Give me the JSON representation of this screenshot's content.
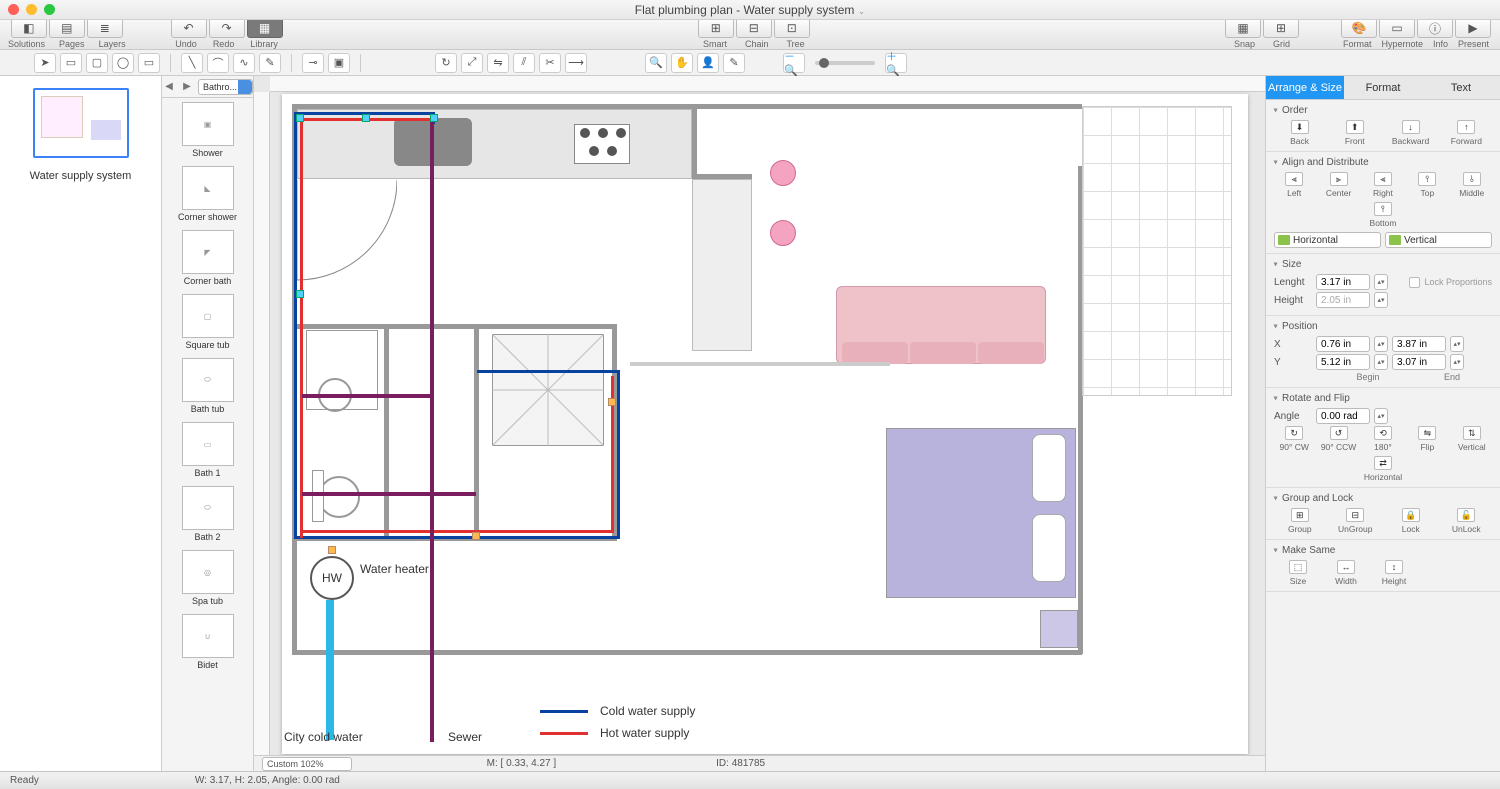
{
  "window": {
    "title": "Flat plumbing plan - Water supply system"
  },
  "toolbar": {
    "solutions": "Solutions",
    "pages": "Pages",
    "layers": "Layers",
    "undo": "Undo",
    "redo": "Redo",
    "library": "Library",
    "smart": "Smart",
    "chain": "Chain",
    "tree": "Tree",
    "snap": "Snap",
    "grid": "Grid",
    "format": "Format",
    "hypernote": "Hypernote",
    "info": "Info",
    "present": "Present"
  },
  "pages_panel": {
    "page1_name": "Water supply system"
  },
  "library": {
    "selector": "Bathro...",
    "items": [
      "Shower",
      "Corner shower",
      "Corner bath",
      "Square tub",
      "Bath tub",
      "Bath 1",
      "Bath 2",
      "Spa tub",
      "Bidet"
    ]
  },
  "canvas_labels": {
    "water_heater": "Water heater",
    "hw": "HW",
    "city_cold": "City cold water",
    "sewer": "Sewer",
    "cold_supply": "Cold water supply",
    "hot_supply": "Hot water supply"
  },
  "inspector": {
    "tabs": [
      "Arrange & Size",
      "Format",
      "Text"
    ],
    "sections": {
      "order": {
        "title": "Order",
        "btns": [
          "Back",
          "Front",
          "Backward",
          "Forward"
        ]
      },
      "align": {
        "title": "Align and Distribute",
        "btns": [
          "Left",
          "Center",
          "Right",
          "Top",
          "Middle",
          "Bottom"
        ],
        "h": "Horizontal",
        "v": "Vertical"
      },
      "size": {
        "title": "Size",
        "length_lbl": "Lenght",
        "length_val": "3.17 in",
        "height_lbl": "Height",
        "height_val": "2.05 in",
        "lock": "Lock Proportions"
      },
      "position": {
        "title": "Position",
        "x_lbl": "X",
        "x1": "0.76 in",
        "x2": "3.87 in",
        "y_lbl": "Y",
        "y1": "5.12 in",
        "y2": "3.07 in",
        "begin": "Begin",
        "end": "End"
      },
      "rotate": {
        "title": "Rotate and Flip",
        "angle_lbl": "Angle",
        "angle_val": "0.00 rad",
        "btns": [
          "90° CW",
          "90° CCW",
          "180°",
          "Flip",
          "Vertical",
          "Horizontal"
        ]
      },
      "group": {
        "title": "Group and Lock",
        "btns": [
          "Group",
          "UnGroup",
          "Lock",
          "UnLock"
        ]
      },
      "same": {
        "title": "Make Same",
        "btns": [
          "Size",
          "Width",
          "Height"
        ]
      }
    }
  },
  "canvas_status": {
    "zoom": "Custom 102%",
    "m": "M: [ 0.33, 4.27 ]",
    "id": "ID: 481785"
  },
  "statusbar": {
    "ready": "Ready",
    "dims": "W: 3.17,  H: 2.05,  Angle: 0.00 rad"
  }
}
